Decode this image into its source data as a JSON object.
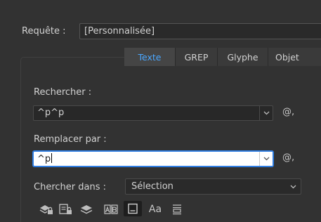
{
  "query": {
    "label": "Requête :",
    "value": "[Personnalisée]"
  },
  "tabs": [
    {
      "label": "Texte",
      "active": true
    },
    {
      "label": "GREP",
      "active": false
    },
    {
      "label": "Glyphe",
      "active": false
    },
    {
      "label": "Objet",
      "active": false
    }
  ],
  "find": {
    "label": "Rechercher :",
    "value": "^p^p"
  },
  "replace": {
    "label": "Remplacer par :",
    "value": "^p"
  },
  "special_char_label": "@,",
  "search_in": {
    "label": "Chercher dans :",
    "value": "Sélection"
  },
  "options": {
    "case_label": "Aa",
    "icons": [
      "include-locked-layers-icon",
      "include-locked-stories-icon",
      "include-hidden-layers-icon",
      "include-master-pages-icon",
      "include-footnotes-icon",
      "case-sensitive-icon",
      "whole-word-icon"
    ]
  },
  "colors": {
    "background": "#323232",
    "accent": "#4aa7ff",
    "focus_border": "#2f7de1"
  }
}
